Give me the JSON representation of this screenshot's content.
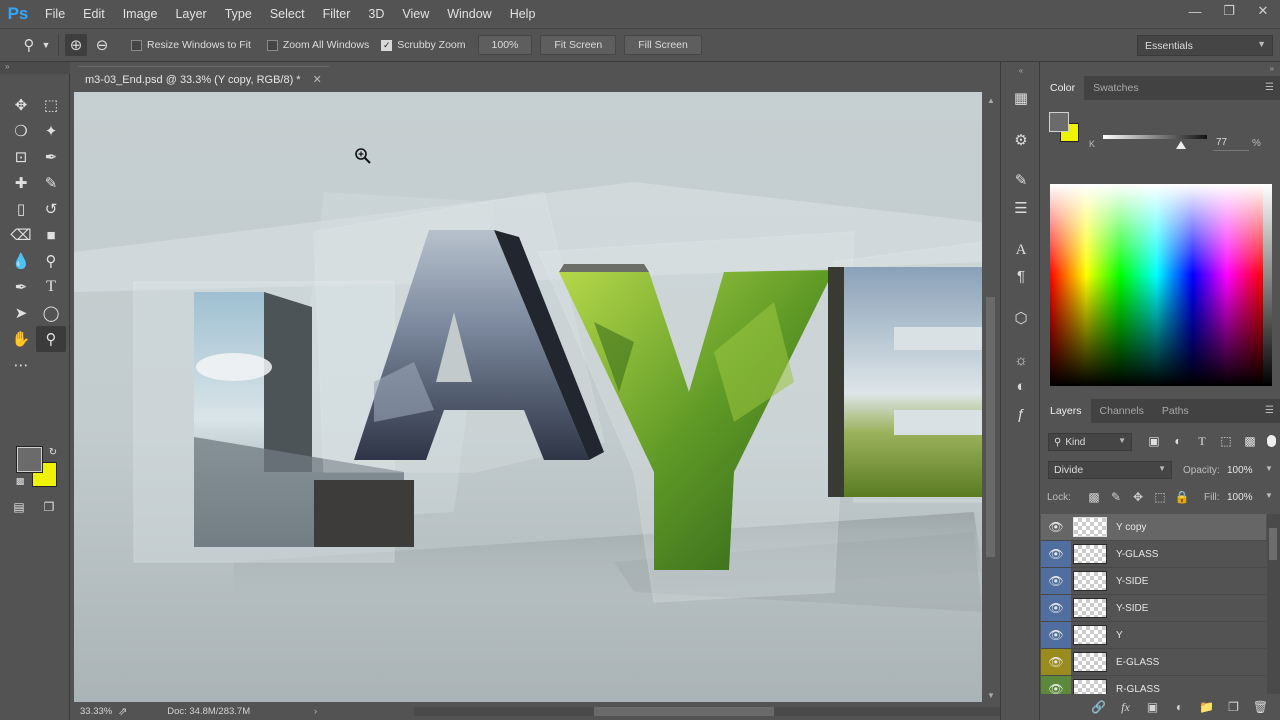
{
  "app": {
    "logo": "Ps",
    "menu": [
      "File",
      "Edit",
      "Image",
      "Layer",
      "Type",
      "Select",
      "Filter",
      "3D",
      "View",
      "Window",
      "Help"
    ]
  },
  "options_bar": {
    "resize_windows": "Resize Windows to Fit",
    "zoom_all_windows": "Zoom All Windows",
    "scrubby_zoom": "Scrubby Zoom",
    "scrubby_checked": true,
    "zoom_100": "100%",
    "fit_screen": "Fit Screen",
    "fill_screen": "Fill Screen",
    "workspace": "Essentials"
  },
  "document": {
    "tab_title": "m3-03_End.psd @ 33.3% (Y copy, RGB/8) *",
    "zoom": "33.33%",
    "doc_size": "Doc: 34.8M/283.7M"
  },
  "tools": {
    "foreground_color": "#6b6b6b",
    "background_color": "#eef205"
  },
  "color_panel": {
    "tabs": [
      "Color",
      "Swatches"
    ],
    "channel_label": "K",
    "k_value": "77",
    "unit": "%"
  },
  "layers_panel": {
    "tabs": [
      "Layers",
      "Channels",
      "Paths"
    ],
    "filter_kind": "Kind",
    "blend_mode": "Divide",
    "opacity_label": "Opacity:",
    "opacity_value": "100%",
    "lock_label": "Lock:",
    "fill_label": "Fill:",
    "fill_value": "100%",
    "layers": [
      {
        "name": "Y copy",
        "selected": true,
        "color": "none"
      },
      {
        "name": "Y-GLASS",
        "selected": false,
        "color": "#516ea0"
      },
      {
        "name": "Y-SIDE",
        "selected": false,
        "color": "#516ea0"
      },
      {
        "name": "Y-SIDE",
        "selected": false,
        "color": "#516ea0"
      },
      {
        "name": "Y",
        "selected": false,
        "color": "#516ea0"
      },
      {
        "name": "E-GLASS",
        "selected": false,
        "color": "#9a8b1e"
      },
      {
        "name": "R-GLASS",
        "selected": false,
        "color": "#5c8a3a"
      }
    ]
  },
  "artwork": {
    "letters": [
      "L",
      "A",
      "Y",
      "E"
    ]
  }
}
